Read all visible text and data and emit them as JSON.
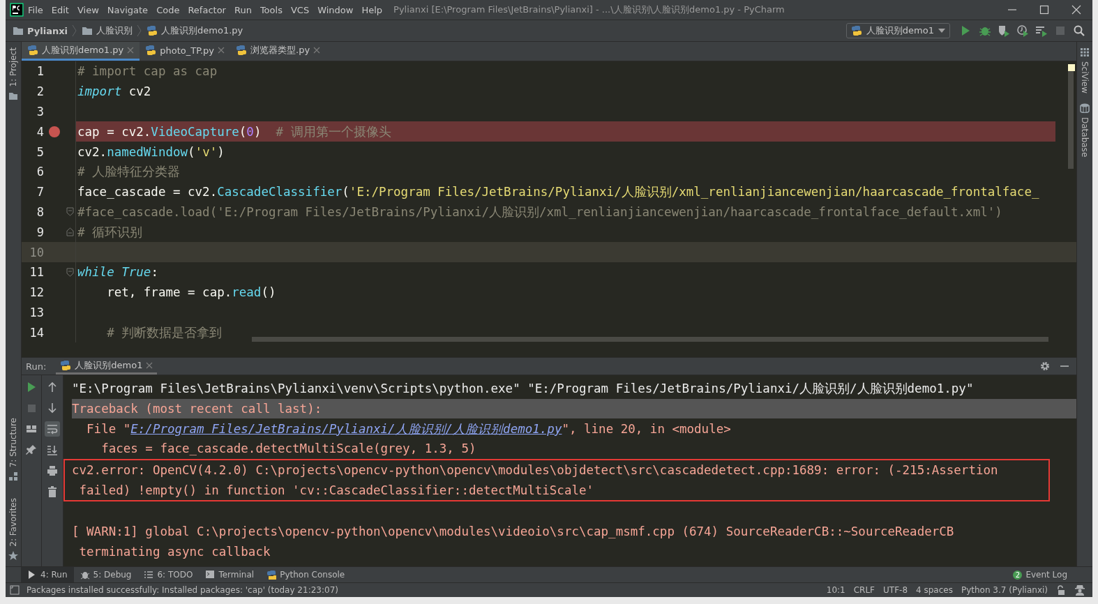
{
  "window": {
    "title": "Pylianxi [E:\\Program Files\\JetBrains\\Pylianxi] - ...\\人脸识别\\人脸识别demo1.py - PyCharm"
  },
  "menu": [
    "File",
    "Edit",
    "View",
    "Navigate",
    "Code",
    "Refactor",
    "Run",
    "Tools",
    "VCS",
    "Window",
    "Help"
  ],
  "breadcrumb": [
    {
      "label": "Pylianxi",
      "kind": "project"
    },
    {
      "label": "人脸识别",
      "kind": "folder"
    },
    {
      "label": "人脸识别demo1.py",
      "kind": "file"
    }
  ],
  "run_config": {
    "label": "人脸识别demo1"
  },
  "toolbar": [
    {
      "kind": "run",
      "disabled": false
    },
    {
      "kind": "debug",
      "disabled": false
    },
    {
      "kind": "coverage",
      "disabled": false
    },
    {
      "kind": "profile",
      "disabled": false
    },
    {
      "kind": "concurrency",
      "disabled": false
    },
    {
      "kind": "stop",
      "disabled": true
    },
    {
      "kind": "search",
      "disabled": false
    }
  ],
  "left_bar": {
    "top": [
      {
        "label": "1: Project",
        "kind": "project"
      }
    ],
    "bottom": [
      {
        "label": "7: Structure",
        "kind": "structure"
      },
      {
        "label": "2: Favorites",
        "kind": "favorites"
      }
    ]
  },
  "right_bar": [
    {
      "label": "SciView",
      "kind": "sciview"
    },
    {
      "label": "Database",
      "kind": "database"
    }
  ],
  "tabs": [
    {
      "label": "人脸识别demo1.py",
      "selected": true
    },
    {
      "label": "photo_TP.py",
      "selected": false
    },
    {
      "label": "浏览器类型.py",
      "selected": false
    }
  ],
  "editor": {
    "lines": [
      {
        "number": "1",
        "breakpoint": false,
        "current": false,
        "fold_start": false,
        "fold_end": false,
        "tokens": [
          {
            "kind": "comment",
            "text": "# import cap as cap"
          }
        ]
      },
      {
        "number": "2",
        "breakpoint": false,
        "current": false,
        "fold_start": false,
        "fold_end": false,
        "tokens": [
          {
            "kind": "keyword",
            "text": "import"
          },
          {
            "kind": "plain",
            "text": " cv2"
          }
        ]
      },
      {
        "number": "3",
        "breakpoint": false,
        "current": false,
        "fold_start": false,
        "fold_end": false
      },
      {
        "number": "4",
        "breakpoint": true,
        "current": false,
        "fold_start": false,
        "fold_end": false,
        "tokens": [
          {
            "kind": "plain",
            "text": "cap = cv2."
          },
          {
            "kind": "call",
            "text": "VideoCapture"
          },
          {
            "kind": "plain",
            "text": "("
          },
          {
            "kind": "number",
            "text": "0"
          },
          {
            "kind": "plain",
            "text": ")  "
          },
          {
            "kind": "comment",
            "text": "# 调用第一个摄像头"
          }
        ]
      },
      {
        "number": "5",
        "breakpoint": false,
        "current": false,
        "fold_start": false,
        "fold_end": false,
        "tokens": [
          {
            "kind": "plain",
            "text": "cv2."
          },
          {
            "kind": "call",
            "text": "namedWindow"
          },
          {
            "kind": "plain",
            "text": "("
          },
          {
            "kind": "string",
            "text": "'v'"
          },
          {
            "kind": "plain",
            "text": ")"
          }
        ]
      },
      {
        "number": "6",
        "breakpoint": false,
        "current": false,
        "fold_start": false,
        "fold_end": false,
        "tokens": [
          {
            "kind": "comment",
            "text": "# 人脸特征分类器"
          }
        ]
      },
      {
        "number": "7",
        "breakpoint": false,
        "current": false,
        "fold_start": false,
        "fold_end": false,
        "tokens": [
          {
            "kind": "plain",
            "text": "face_cascade = cv2."
          },
          {
            "kind": "call",
            "text": "CascadeClassifier"
          },
          {
            "kind": "plain",
            "text": "("
          },
          {
            "kind": "string",
            "text": "'E:/Program Files/JetBrains/Pylianxi/人脸识别/xml_renlianjiancewenjian/haarcascade_frontalface_"
          }
        ]
      },
      {
        "number": "8",
        "breakpoint": false,
        "current": false,
        "fold_start": true,
        "fold_end": false,
        "tokens": [
          {
            "kind": "comment",
            "text": "#face_cascade.load('E:/Program Files/JetBrains/Pylianxi/人脸识别/xml_renlianjiancewenjian/haarcascade_frontalface_default.xml')"
          }
        ]
      },
      {
        "number": "9",
        "breakpoint": false,
        "current": false,
        "fold_start": false,
        "fold_end": true,
        "tokens": [
          {
            "kind": "comment",
            "text": "# 循环识别"
          }
        ]
      },
      {
        "number": "10",
        "breakpoint": false,
        "current": true,
        "fold_start": false,
        "fold_end": false
      },
      {
        "number": "11",
        "breakpoint": false,
        "current": false,
        "fold_start": true,
        "fold_end": false,
        "tokens": [
          {
            "kind": "keyword",
            "text": "while"
          },
          {
            "kind": "keyword",
            "text": " True"
          },
          {
            "kind": "plain",
            "text": ":"
          }
        ]
      },
      {
        "number": "12",
        "breakpoint": false,
        "current": false,
        "fold_start": false,
        "fold_end": false,
        "tokens": [
          {
            "kind": "plain",
            "text": "    ret, frame = cap."
          },
          {
            "kind": "call",
            "text": "read"
          },
          {
            "kind": "plain",
            "text": "()"
          }
        ]
      },
      {
        "number": "13",
        "breakpoint": false,
        "current": false,
        "fold_start": false,
        "fold_end": false
      },
      {
        "number": "14",
        "breakpoint": false,
        "current": false,
        "fold_start": false,
        "fold_end": false,
        "tokens": [
          {
            "kind": "comment",
            "text": "    # 判断数据是否拿到"
          }
        ]
      }
    ]
  },
  "run_panel": {
    "title": "Run:",
    "tab": {
      "label": "人脸识别demo1"
    },
    "side_tools": [
      {
        "kind": "rerun",
        "selected": false
      },
      {
        "kind": "stop",
        "selected": false
      },
      {
        "kind": "layout",
        "selected": false
      },
      {
        "kind": "pin",
        "selected": false
      }
    ],
    "console_tools": [
      {
        "kind": "up",
        "selected": false
      },
      {
        "kind": "down",
        "selected": false
      },
      {
        "kind": "wrap",
        "selected": true
      },
      {
        "kind": "scroll-end",
        "selected": false
      },
      {
        "kind": "print",
        "selected": false
      },
      {
        "kind": "trash",
        "selected": false
      }
    ],
    "lines": [
      {
        "kind": "command",
        "highlighted": false,
        "framed": false,
        "gap_before": false,
        "text": "\"E:\\Program Files\\JetBrains\\Pylianxi\\venv\\Scripts\\python.exe\" \"E:/Program Files/JetBrains/Pylianxi/人脸识别/人脸识别demo1.py\""
      },
      {
        "kind": "error",
        "highlighted": true,
        "framed": false,
        "gap_before": false,
        "text": "Traceback (most recent call last):"
      },
      {
        "kind": "error",
        "highlighted": false,
        "framed": false,
        "gap_before": false,
        "text": "  File \"",
        "link": "E:/Program Files/JetBrains/Pylianxi/人脸识别/人脸识别demo1.py",
        "after": "\", line 20, in <module>"
      },
      {
        "kind": "error",
        "highlighted": false,
        "framed": false,
        "gap_before": false,
        "text": "    faces = face_cascade.detectMultiScale(grey, 1.3, 5)"
      },
      {
        "kind": "error",
        "highlighted": false,
        "framed": true,
        "gap_before": false,
        "text": "cv2.error: OpenCV(4.2.0) C:\\projects\\opencv-python\\opencv\\modules\\objdetect\\src\\cascadedetect.cpp:1689: error: (-215:Assertion"
      },
      {
        "kind": "error",
        "highlighted": false,
        "framed": true,
        "gap_before": false,
        "text": " failed) !empty() in function 'cv::CascadeClassifier::detectMultiScale'"
      },
      {
        "kind": "error",
        "highlighted": false,
        "framed": false,
        "gap_before": true,
        "text": "[ WARN:1] global C:\\projects\\opencv-python\\opencv\\modules\\videoio\\src\\cap_msmf.cpp (674) SourceReaderCB::~SourceReaderCB"
      },
      {
        "kind": "error",
        "highlighted": false,
        "framed": false,
        "gap_before": false,
        "text": " terminating async callback"
      }
    ]
  },
  "bottom_tabs": [
    {
      "label": "4: Run",
      "kind": "run",
      "selected": true
    },
    {
      "label": "5: Debug",
      "kind": "debug",
      "selected": false
    },
    {
      "label": "6: TODO",
      "kind": "todo",
      "selected": false
    },
    {
      "label": "Terminal",
      "kind": "terminal",
      "selected": false
    },
    {
      "label": "Python Console",
      "kind": "python",
      "selected": false
    }
  ],
  "event_log": {
    "label": "Event Log",
    "count": "2"
  },
  "status_bar": {
    "message": "Packages installed successfully: Installed packages: 'cap' (today 21:23:07)",
    "items": [
      "10:1",
      "CRLF",
      "UTF-8",
      "4 spaces",
      "Python 3.7 (Pylianxi)"
    ]
  }
}
